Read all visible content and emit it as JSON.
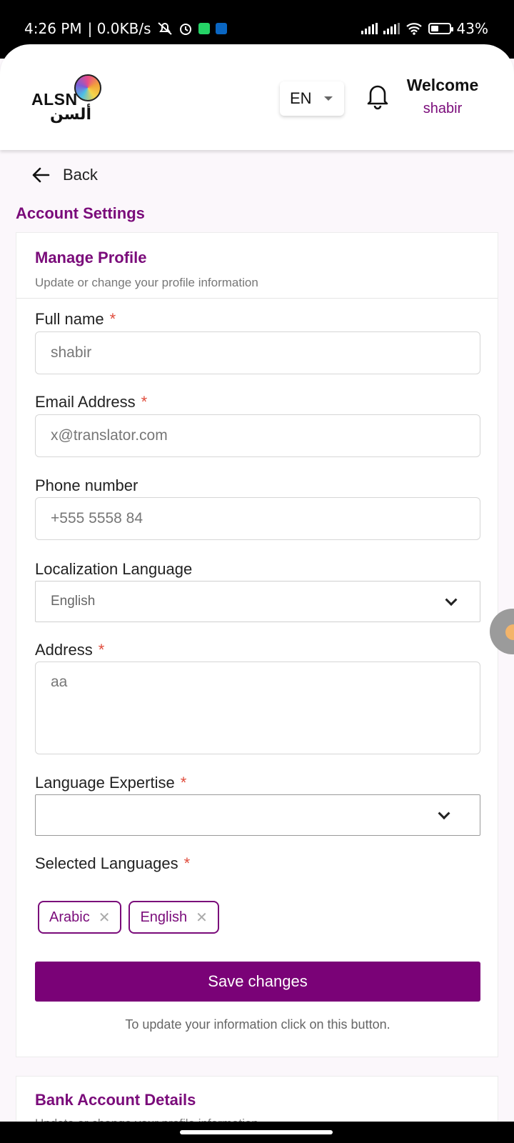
{
  "status_bar": {
    "time": "4:26 PM",
    "speed": "| 0.0KB/s",
    "battery": "43%",
    "battery_level": 0.43,
    "icons": [
      "mute-icon",
      "alarm-icon",
      "whatsapp-icon",
      "linkedin-icon",
      "signal-icon",
      "wifi-icon",
      "battery-icon"
    ]
  },
  "header": {
    "logo_text": "ALSN",
    "logo_arabic": "ألسن",
    "language": "EN",
    "welcome": "Welcome",
    "username": "shabir"
  },
  "nav": {
    "back_label": "Back"
  },
  "page": {
    "title": "Account Settings"
  },
  "profile": {
    "title": "Manage Profile",
    "subtitle": "Update or change your profile information",
    "full_name": {
      "label": "Full name",
      "required": "*",
      "value": "shabir"
    },
    "email": {
      "label": "Email Address",
      "required": "*",
      "value": "x@translator.com"
    },
    "phone": {
      "label": "Phone number",
      "value": "+555 5558 84"
    },
    "localization": {
      "label": "Localization Language",
      "value": "English"
    },
    "address": {
      "label": "Address",
      "required": "*",
      "value": "aa"
    },
    "expertise": {
      "label": "Language Expertise",
      "required": "*",
      "value": ""
    },
    "selected": {
      "label": "Selected Languages",
      "required": "*",
      "chips": [
        "Arabic",
        "English"
      ],
      "remove_glyph": "✕"
    },
    "save_label": "Save changes",
    "hint": "To update your information click on this button."
  },
  "bank": {
    "title": "Bank Account Details",
    "subtitle": "Update or change your profile information"
  },
  "colors": {
    "brand": "#7a0277",
    "required": "#e04c3c",
    "border": "#d6d6d6"
  }
}
